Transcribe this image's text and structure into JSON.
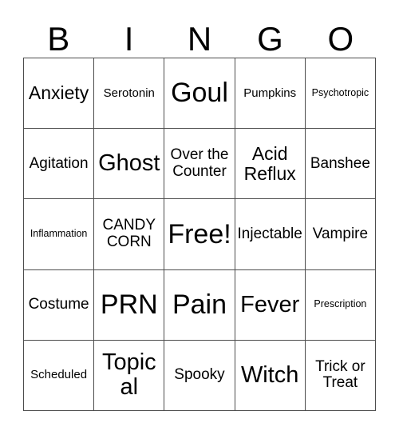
{
  "card": {
    "title": "BINGO",
    "header_letters": [
      "B",
      "I",
      "N",
      "G",
      "O"
    ],
    "rows": [
      [
        {
          "text": "Anxiety",
          "size": "sz-l"
        },
        {
          "text": "Serotonin",
          "size": "sz-s"
        },
        {
          "text": "Goul",
          "size": "sz-xxl"
        },
        {
          "text": "Pumpkins",
          "size": "sz-s"
        },
        {
          "text": "Psychotropic",
          "size": "sz-xs"
        }
      ],
      [
        {
          "text": "Agitation",
          "size": "sz-m"
        },
        {
          "text": "Ghost",
          "size": "sz-xl"
        },
        {
          "text": "Over the Counter",
          "size": "sz-m"
        },
        {
          "text": "Acid Reflux",
          "size": "sz-l"
        },
        {
          "text": "Banshee",
          "size": "sz-m"
        }
      ],
      [
        {
          "text": "Inflammation",
          "size": "sz-xs"
        },
        {
          "text": "CANDY CORN",
          "size": "sz-m"
        },
        {
          "text": "Free!",
          "size": "sz-xxl"
        },
        {
          "text": "Injectable",
          "size": "sz-m"
        },
        {
          "text": "Vampire",
          "size": "sz-m"
        }
      ],
      [
        {
          "text": "Costume",
          "size": "sz-m"
        },
        {
          "text": "PRN",
          "size": "sz-xxl"
        },
        {
          "text": "Pain",
          "size": "sz-xxl"
        },
        {
          "text": "Fever",
          "size": "sz-xl"
        },
        {
          "text": "Prescription",
          "size": "sz-xs"
        }
      ],
      [
        {
          "text": "Scheduled",
          "size": "sz-s"
        },
        {
          "text": "Topical",
          "size": "sz-xl"
        },
        {
          "text": "Spooky",
          "size": "sz-m"
        },
        {
          "text": "Witch",
          "size": "sz-xl"
        },
        {
          "text": "Trick or Treat",
          "size": "sz-m"
        }
      ]
    ],
    "colors": {
      "background": "#ffffff",
      "text": "#000000",
      "grid_line": "#4d4d4d"
    }
  }
}
